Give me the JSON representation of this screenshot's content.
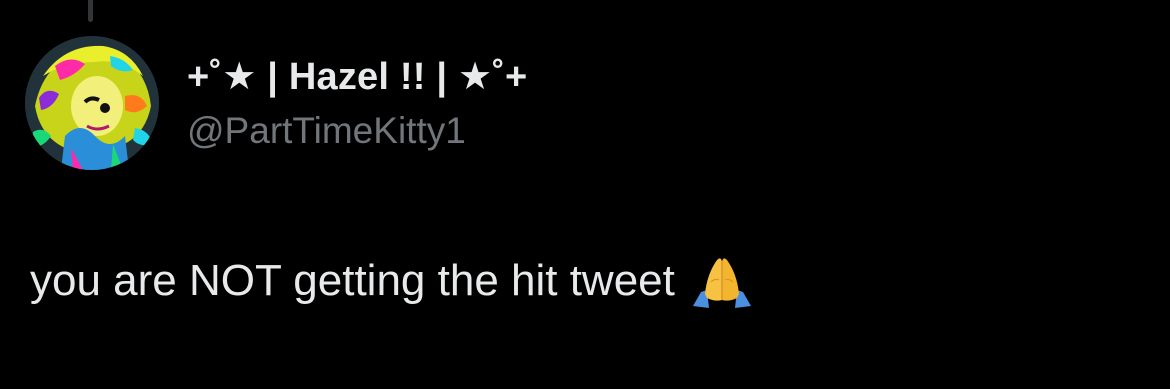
{
  "tweet": {
    "author": {
      "display_name": "+˚★ | Hazel !! | ★˚+",
      "handle": "@PartTimeKitty1",
      "avatar_icon": "profile-avatar"
    },
    "text": "you are NOT getting the hit tweet",
    "emoji": "folded-hands-icon"
  },
  "colors": {
    "background": "#000000",
    "primary_text": "#e7e9ea",
    "secondary_text": "#71767b"
  }
}
